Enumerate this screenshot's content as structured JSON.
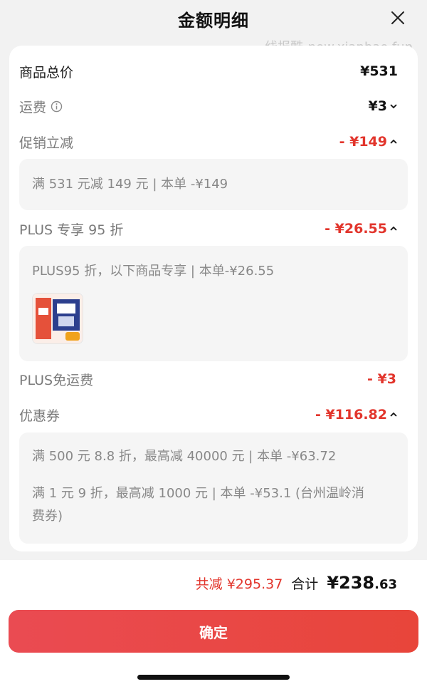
{
  "header": {
    "title": "金额明细"
  },
  "watermark": "线报酷-new.xianbao.fun",
  "rows": {
    "goods_total": {
      "label": "商品总价",
      "amount": "¥531"
    },
    "shipping": {
      "label": "运费",
      "amount": "¥3"
    },
    "promo": {
      "label": "促销立减",
      "amount": "- ¥149",
      "detail": "满 531 元减 149 元 | 本单 -¥149"
    },
    "plus_discount": {
      "label": "PLUS 专享 95 折",
      "amount": "- ¥26.55",
      "detail": "PLUS95 折，以下商品专享 | 本单-¥26.55"
    },
    "plus_free_shipping": {
      "label": "PLUS免运费",
      "amount": "- ¥3"
    },
    "coupon": {
      "label": "优惠券",
      "amount": "- ¥116.82",
      "details": [
        "满 500 元 8.8 折，最高减 40000 元 | 本单 -¥63.72",
        "满 1 元 9 折，最高减 1000 元 | 本单 -¥53.1 (台州温岭消",
        "费券)"
      ]
    }
  },
  "footer": {
    "saved": "共减 ¥295.37",
    "total_label": "合计",
    "total_main": "¥238",
    "total_cents": ".63",
    "confirm_label": "确定"
  },
  "colors": {
    "accent": "#e2352c",
    "button": "#e8453a"
  }
}
